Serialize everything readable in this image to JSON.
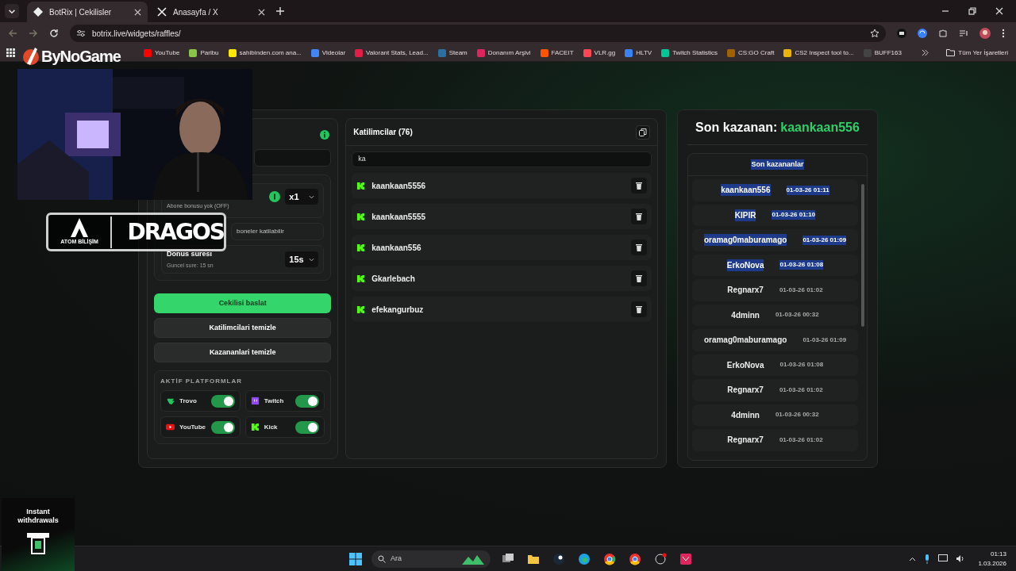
{
  "browser": {
    "tabs": [
      {
        "title": "BotRix | Cekilisler",
        "selected": true
      },
      {
        "title": "Anasayfa / X",
        "selected": false
      }
    ],
    "url": "botrix.live/widgets/raffles/",
    "bookmarks": [
      {
        "label": "YouTube",
        "color": "#ff0000"
      },
      {
        "label": "Paribu",
        "color": "#8bc34a"
      },
      {
        "label": "sahibinden.com ana...",
        "color": "#ffe800"
      },
      {
        "label": "Videolar",
        "color": "#4285f4"
      },
      {
        "label": "Valorant Stats, Lead...",
        "color": "#e11d48"
      },
      {
        "label": "Steam",
        "color": "#2a6f9e"
      },
      {
        "label": "Donanım Arşivi",
        "color": "#e0245e"
      },
      {
        "label": "FACEIT",
        "color": "#ff5500"
      },
      {
        "label": "VLR.gg",
        "color": "#ff4655"
      },
      {
        "label": "HLTV",
        "color": "#3b82f6"
      },
      {
        "label": "Twitch Statistics",
        "color": "#00c896"
      },
      {
        "label": "CS:GO Craft",
        "color": "#a16207"
      },
      {
        "label": "CS2 Inspect tool to...",
        "color": "#eab308"
      },
      {
        "label": "BUFF163",
        "color": "#444444"
      }
    ],
    "all_bookmarks": "Tüm Yer İşaretleri"
  },
  "overlays": {
    "brand_logo": "ByNoGame",
    "sponsor_left": "ATOM BİLİŞİM",
    "sponsor_right": "DRAGOS",
    "ad": "Instant withdrawals"
  },
  "settings": {
    "bonus_label": "Abone bonusu yok (OFF)",
    "multiplier": "x1",
    "subscriber_field": "boneler katilabilir",
    "spin_title": "Donus suresi",
    "spin_note": "Guncel sure: 15 sn",
    "spin_value": "15s"
  },
  "actions": [
    {
      "label": "Cekilisi baslat",
      "kind": "primary"
    },
    {
      "label": "Katilimcilari temizle",
      "kind": "secondary"
    },
    {
      "label": "Kazananlari temizle",
      "kind": "secondary"
    }
  ],
  "platforms": {
    "title": "AKTİF PLATFORMLAR",
    "items": [
      {
        "name": "Trovo",
        "kind": "trovo",
        "on": true
      },
      {
        "name": "Twitch",
        "kind": "twitch",
        "on": true
      },
      {
        "name": "YouTube",
        "kind": "youtube",
        "on": true
      },
      {
        "name": "Kick",
        "kind": "kick",
        "on": true
      }
    ]
  },
  "participants": {
    "title": "Katilimcilar (76)",
    "search": "ka",
    "items": [
      {
        "name": "kaankaan5556"
      },
      {
        "name": "kaankaan5555"
      },
      {
        "name": "kaankaan556"
      },
      {
        "name": "Gkarlebach"
      },
      {
        "name": "efekangurbuz"
      }
    ]
  },
  "winners": {
    "label": "Son kazanan:",
    "winner": "kaankaan556",
    "list_title": "Son kazananlar",
    "list_title_selected": true,
    "rows": [
      {
        "name": "kaankaan556",
        "time": "01-03-26 01:11",
        "selected": true
      },
      {
        "name": "KIPIR",
        "time": "01-03-26 01:10",
        "selected": true
      },
      {
        "name": "oramag0maburamago",
        "time": "01-03-26 01:09",
        "selected": true
      },
      {
        "name": "ErkoNova",
        "time": "01-03-26 01:08",
        "selected": true
      },
      {
        "name": "Regnarx7",
        "time": "01-03-26 01:02",
        "selected": false
      },
      {
        "name": "4dminn",
        "time": "01-03-26 00:32",
        "selected": false
      },
      {
        "name": "oramag0maburamago",
        "time": "01-03-26 01:09",
        "selected": false
      },
      {
        "name": "ErkoNova",
        "time": "01-03-26 01:08",
        "selected": false
      },
      {
        "name": "Regnarx7",
        "time": "01-03-26 01:02",
        "selected": false
      },
      {
        "name": "4dminn",
        "time": "01-03-26 00:32",
        "selected": false
      },
      {
        "name": "Regnarx7",
        "time": "01-03-26 01:02",
        "selected": false
      }
    ]
  },
  "taskbar": {
    "search_placeholder": "Ara",
    "time": "01:13",
    "date": "1.03.2026"
  }
}
